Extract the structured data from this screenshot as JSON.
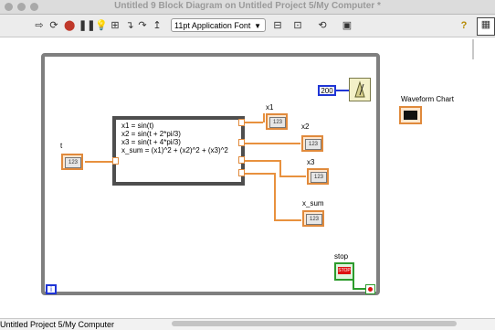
{
  "window": {
    "title": "Untitled 9 Block Diagram on Untitled Project 5/My Computer *"
  },
  "toolbar": {
    "font": "11pt Application Font"
  },
  "formula": {
    "lines": [
      "x1 = sin(t)",
      "x2 = sin(t + 2*pi/3)",
      "x3 = sin(t + 4*pi/3)",
      "x_sum = (x1)^2 + (x2)^2 + (x3)^2"
    ]
  },
  "terminals": {
    "t": "t",
    "x1": "x1",
    "x2": "x2",
    "x3": "x3",
    "x_sum": "x_sum",
    "stop": "stop",
    "indicator_text": "123",
    "stop_text": "STOP"
  },
  "constant": {
    "value": "200"
  },
  "chart": {
    "label": "Waveform Chart"
  },
  "loop": {
    "iteration": "i"
  },
  "status": {
    "text": "Untitled Project 5/My Computer"
  }
}
